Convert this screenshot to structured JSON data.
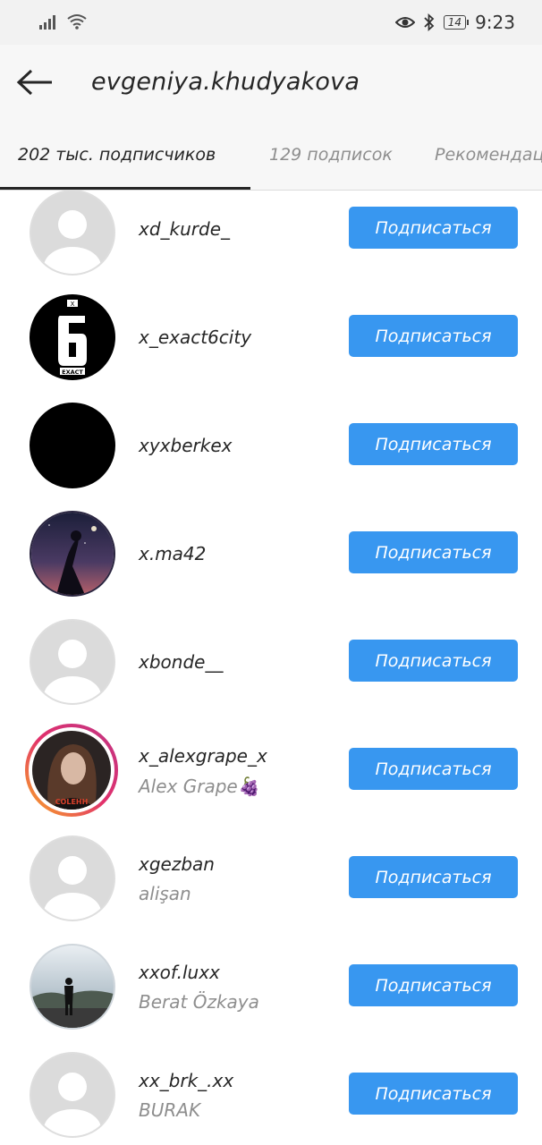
{
  "status_bar": {
    "time": "9:23",
    "battery": "14",
    "icons": [
      "signal-icon",
      "wifi-icon",
      "eye-icon",
      "bluetooth-icon",
      "battery-icon"
    ]
  },
  "header": {
    "title": "evgeniya.khudyakova"
  },
  "tabs": [
    {
      "label": "202 тыс. подписчиков",
      "active": true
    },
    {
      "label": "129 подписок",
      "active": false
    },
    {
      "label": "Рекомендации",
      "active": false
    }
  ],
  "colors": {
    "accent": "#3897f0",
    "text": "#262626",
    "secondary_text": "#8e8e8e"
  },
  "follow_label": "Подписаться",
  "followers": [
    {
      "username": "xd_kurde_",
      "full_name": "",
      "avatar": "default-avatar-icon"
    },
    {
      "username": "x_exact6city",
      "full_name": "",
      "avatar": "exact6-logo"
    },
    {
      "username": "xyxberkex",
      "full_name": "",
      "avatar": "black-avatar"
    },
    {
      "username": "x.ma42",
      "full_name": "",
      "avatar": "night-sky-photo"
    },
    {
      "username": "xbonde__",
      "full_name": "",
      "avatar": "default-avatar-icon"
    },
    {
      "username": "x_alexgrape_x",
      "full_name": "Alex Grape🍇",
      "avatar": "girl-photo-with-story-ring"
    },
    {
      "username": "xgezban",
      "full_name": "alişan",
      "avatar": "default-avatar-icon"
    },
    {
      "username": "xxof.luxx",
      "full_name": "Berat Özkaya",
      "avatar": "landscape-person-photo"
    },
    {
      "username": "xx_brk_.xx",
      "full_name": "BURAK",
      "avatar": "default-avatar-icon"
    }
  ]
}
